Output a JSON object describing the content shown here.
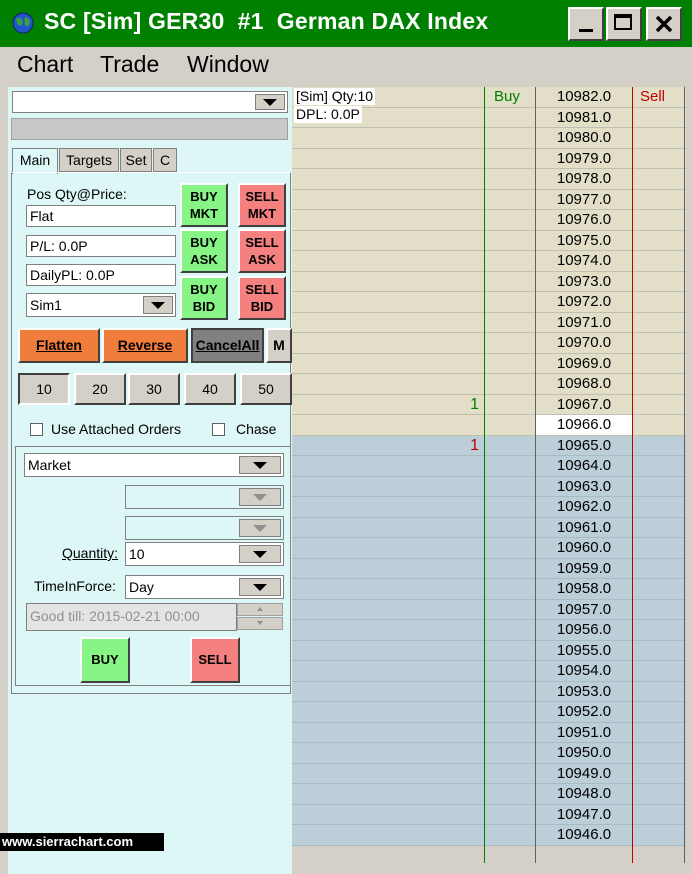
{
  "window": {
    "title": "SC [Sim] GER30  #1  German DAX Index",
    "minimize_label": "_",
    "close_label": "X"
  },
  "menu": [
    "Chart",
    "Trade",
    "Window"
  ],
  "panel": {
    "symbol_combo_value": "",
    "tabs": [
      "Main",
      "Targets",
      "Set",
      "C"
    ],
    "active_tab": "Main",
    "pos_label": "Pos Qty@Price:",
    "pos_value": "Flat",
    "pl_value": "P/L: 0.0P",
    "daily_pl_value": "DailyPL: 0.0P",
    "account": "Sim1",
    "buy_mkt": [
      "BUY",
      "MKT"
    ],
    "sell_mkt": [
      "SELL",
      "MKT"
    ],
    "buy_ask": [
      "BUY",
      "ASK"
    ],
    "sell_ask": [
      "SELL",
      "ASK"
    ],
    "buy_bid": [
      "BUY",
      "BID"
    ],
    "sell_bid": [
      "SELL",
      "BID"
    ],
    "flatten": "Flatten",
    "reverse": "Reverse",
    "cancel_all": "CancelAll",
    "m": "M",
    "qty_buttons": [
      "10",
      "20",
      "30",
      "40",
      "50"
    ],
    "selected_qty": "10",
    "use_attached_orders": "Use Attached Orders",
    "chase": "Chase",
    "order_type": "Market",
    "quantity_label": "Quantity:",
    "quantity_value": "10",
    "tif_label": "TimeInForce:",
    "tif_value": "Day",
    "good_till": "Good till: 2015-02-21 00:00",
    "buy_button": "BUY",
    "sell_button": "SELL"
  },
  "watermark": "www.sierrachart.com",
  "dom": {
    "info_line1": "[Sim]  Qty:10",
    "info_line2": "DPL: 0.0P",
    "buy_header": "Buy",
    "sell_header": "Sell",
    "colors": {
      "ask_bg": "#e3dec7",
      "bid_bg": "#bccfd9",
      "buy": "#008000",
      "sell": "#c00000"
    },
    "last_price": "10966.0",
    "rows": [
      {
        "price": "10982.0",
        "side": "ask",
        "buy": ""
      },
      {
        "price": "10981.0",
        "side": "ask",
        "buy": ""
      },
      {
        "price": "10980.0",
        "side": "ask",
        "buy": ""
      },
      {
        "price": "10979.0",
        "side": "ask",
        "buy": ""
      },
      {
        "price": "10978.0",
        "side": "ask",
        "buy": ""
      },
      {
        "price": "10977.0",
        "side": "ask",
        "buy": ""
      },
      {
        "price": "10976.0",
        "side": "ask",
        "buy": ""
      },
      {
        "price": "10975.0",
        "side": "ask",
        "buy": ""
      },
      {
        "price": "10974.0",
        "side": "ask",
        "buy": ""
      },
      {
        "price": "10973.0",
        "side": "ask",
        "buy": ""
      },
      {
        "price": "10972.0",
        "side": "ask",
        "buy": ""
      },
      {
        "price": "10971.0",
        "side": "ask",
        "buy": ""
      },
      {
        "price": "10970.0",
        "side": "ask",
        "buy": ""
      },
      {
        "price": "10969.0",
        "side": "ask",
        "buy": ""
      },
      {
        "price": "10968.0",
        "side": "ask",
        "buy": ""
      },
      {
        "price": "10967.0",
        "side": "ask",
        "buy": "1",
        "buy_color": "#008000"
      },
      {
        "price": "10966.0",
        "side": "ask",
        "buy": "",
        "last": true
      },
      {
        "price": "10965.0",
        "side": "bid",
        "buy": "1",
        "buy_color": "#c00000"
      },
      {
        "price": "10964.0",
        "side": "bid",
        "buy": ""
      },
      {
        "price": "10963.0",
        "side": "bid",
        "buy": ""
      },
      {
        "price": "10962.0",
        "side": "bid",
        "buy": ""
      },
      {
        "price": "10961.0",
        "side": "bid",
        "buy": ""
      },
      {
        "price": "10960.0",
        "side": "bid",
        "buy": ""
      },
      {
        "price": "10959.0",
        "side": "bid",
        "buy": ""
      },
      {
        "price": "10958.0",
        "side": "bid",
        "buy": ""
      },
      {
        "price": "10957.0",
        "side": "bid",
        "buy": ""
      },
      {
        "price": "10956.0",
        "side": "bid",
        "buy": ""
      },
      {
        "price": "10955.0",
        "side": "bid",
        "buy": ""
      },
      {
        "price": "10954.0",
        "side": "bid",
        "buy": ""
      },
      {
        "price": "10953.0",
        "side": "bid",
        "buy": ""
      },
      {
        "price": "10952.0",
        "side": "bid",
        "buy": ""
      },
      {
        "price": "10951.0",
        "side": "bid",
        "buy": ""
      },
      {
        "price": "10950.0",
        "side": "bid",
        "buy": ""
      },
      {
        "price": "10949.0",
        "side": "bid",
        "buy": ""
      },
      {
        "price": "10948.0",
        "side": "bid",
        "buy": ""
      },
      {
        "price": "10947.0",
        "side": "bid",
        "buy": ""
      },
      {
        "price": "10946.0",
        "side": "bid",
        "buy": ""
      }
    ]
  }
}
